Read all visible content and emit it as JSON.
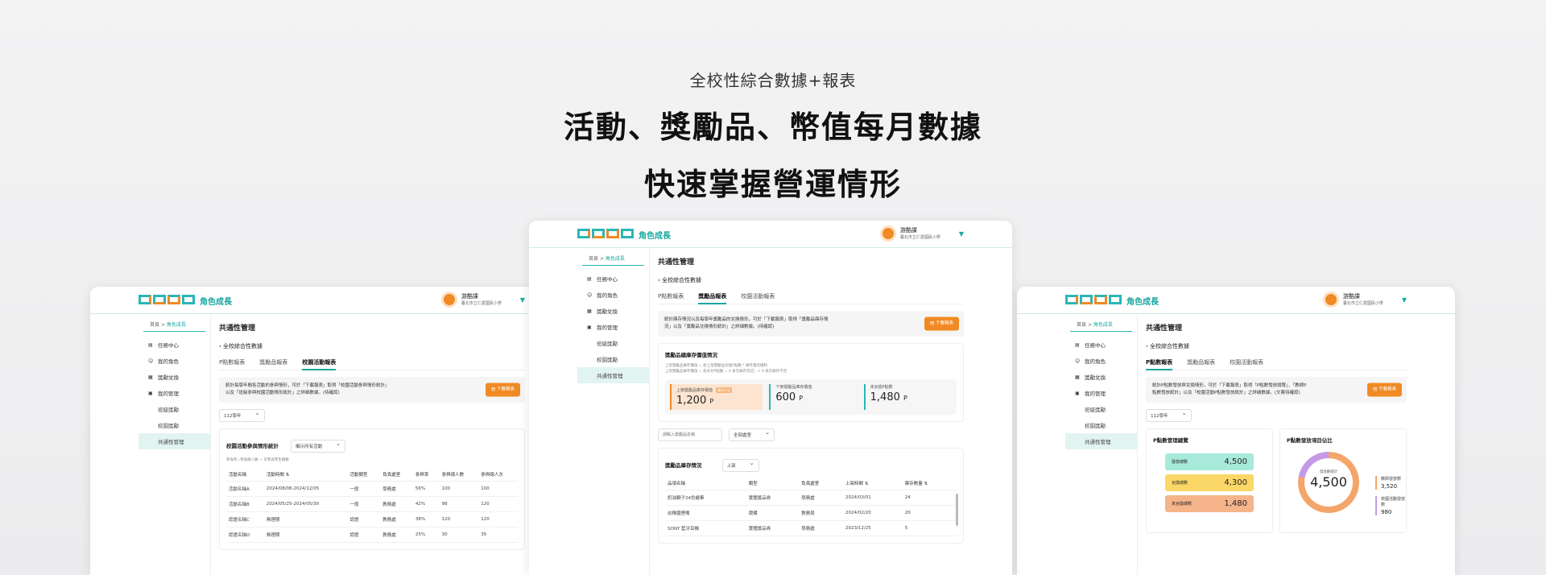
{
  "hero": {
    "subtitle": "全校性綜合數據+報表",
    "line1": "活動、獎勵品、幣值每月數據",
    "line2": "快速掌握營運情形"
  },
  "app": {
    "logo_text": "角色成長",
    "user_name": "游酷課",
    "user_org": "臺北市立仁愛國民小學",
    "breadcrumb_home": "首頁",
    "breadcrumb_sep": ">",
    "breadcrumb_current": "角色成長",
    "page_title": "共通性管理",
    "section_title": "全校綜合性數據",
    "download_label": "下載報表",
    "tabs": [
      "P點數報表",
      "獎勵品報表",
      "校園活動報表"
    ],
    "nav": [
      {
        "icon": "▤",
        "label": "任務中心"
      },
      {
        "icon": "☺",
        "label": "我的角色"
      },
      {
        "icon": "▦",
        "label": "獎勵兌換"
      },
      {
        "icon": "▣",
        "label": "我的管理"
      }
    ],
    "subnav": [
      "班級獎勵",
      "校園獎勵",
      "共通性管理"
    ]
  },
  "left": {
    "note_line1": "統計每學年間各活動的參與情形，可於「下載報表」取得「校園活動參與情形統計」",
    "note_line2": "以及「班級參與校園活動情形統計」之詳細數據。(待確認)",
    "year_select": "112學年",
    "card_title": "校園活動參與情形統計",
    "card_select": "顯示所有活動",
    "hint": "參與率=參與總人數 ÷ 可參與學生總數",
    "columns": [
      "活動名稱",
      "活動時間 ⇅",
      "活動類型",
      "負責處室",
      "參與率",
      "參與總人數",
      "參與總人次"
    ],
    "rows": [
      [
        "活動名稱A",
        "2024/08/08-2024/12/05",
        "一般",
        "學務處",
        "56%",
        "100",
        "100"
      ],
      [
        "活動名稱B",
        "2024/05/25-2024/05/30",
        "一般",
        "教務處",
        "42%",
        "98",
        "120"
      ],
      [
        "認證名稱C",
        "無理期",
        "認證",
        "教務處",
        "38%",
        "120",
        "120"
      ],
      [
        "認證名稱D",
        "無理期",
        "認證",
        "教務處",
        "25%",
        "30",
        "35"
      ]
    ]
  },
  "center": {
    "note_line1": "統計庫存情況以及每學年獎勵品的兌換情形，可於「下載報表」取得「獎勵品庫存情",
    "note_line2": "況」以及「獎勵品兌換情形統計」之詳細數據。(待確認)",
    "card_title": "獎勵品總庫存價值情況",
    "hint_line1": "上架獎勵品庫存價值 = 各上架獎勵品兌換P點數 * 庫存量的總和",
    "hint_line2": "上架獎勵品庫存價值 = 各未兌P點數 = 0 表示庫存充足；< 0 表示庫存不足",
    "stats": [
      {
        "label": "上架獎勵品庫存價值",
        "badge": "庫存不足",
        "value": "1,200",
        "unit": "P"
      },
      {
        "label": "下架獎勵品庫存價值",
        "value": "600",
        "unit": "P"
      },
      {
        "label": "未兌換P點數",
        "value": "1,480",
        "unit": "P"
      }
    ],
    "search_placeholder": "請輸入獎勵品名稱",
    "unit_select": "全部處室",
    "table_title": "獎勵品庫存情況",
    "table_select": "上架",
    "columns": [
      "品項名稱",
      "類型",
      "負責處室",
      "上架時間 ⇅",
      "庫存數量 ⇅"
    ],
    "rows": [
      [
        "奶油獅子24色蠟筆",
        "實體獎品券",
        "學務處",
        "2024/03/01",
        "24"
      ],
      [
        "幼稚園煙嘴",
        "競備",
        "教務局",
        "2024/02/20",
        "20"
      ],
      [
        "SONY 藍牙耳機",
        "實體獎品券",
        "學務處",
        "2023/12/25",
        "5"
      ]
    ]
  },
  "right": {
    "note_line1": "統計P點數發放與兌換情形，可於「下載報表」取得「P點數發放總覽」、「教師P",
    "note_line2": "點數發放統計」以及「校園活動P點數發放統計」之詳細數據。(文案待確認)",
    "year_select": "112學年",
    "overview_title": "P點數管理總覽",
    "pills": [
      {
        "label": "發放總數",
        "value": "4,500",
        "color": "#a8ead9"
      },
      {
        "label": "兌換總數",
        "value": "4,300",
        "color": "#fbd767"
      },
      {
        "label": "未兌換總數",
        "value": "1,480",
        "color": "#f6b48a"
      }
    ],
    "ratio_title": "P點數發放項目佔比",
    "donut_label": "發放數總計",
    "donut_value": "4,500",
    "legend": [
      {
        "label": "教師發放數",
        "value": "3,520"
      },
      {
        "label": "校園活動發放數",
        "value": "980"
      }
    ]
  },
  "colors": {
    "accent": "#1aa8a0",
    "orange": "#f08a24"
  }
}
